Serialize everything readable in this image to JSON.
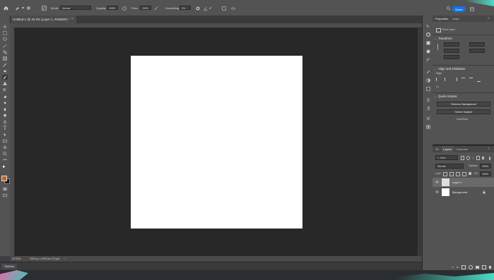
{
  "options_bar": {
    "mode_label": "Mode:",
    "mode_value": "Normal",
    "opacity_label": "Opacity:",
    "opacity_value": "100%",
    "flow_label": "Flow:",
    "flow_value": "100%",
    "smoothing_label": "Smoothing:",
    "smoothing_value": "0%",
    "angle_value": "0°",
    "share_label": "Share"
  },
  "document": {
    "tab_title": "Untitled-1 @ 33.3% (Layer 1, RGB/8#) *"
  },
  "status_bar": {
    "zoom": "33.33%",
    "dimensions": "2000 px x 2000 px (72 ppi)"
  },
  "timeline": {
    "label": "Timeline"
  },
  "properties": {
    "tab_properties": "Properties",
    "tab_adjustments": "Adjus",
    "kind": "Pixel Layer",
    "transform_header": "Transform",
    "align_header": "Align and Distribute",
    "align_label": "Align:",
    "quick_actions_header": "Quick Actions",
    "remove_bg_button": "Remove Background",
    "select_subject_button": "Select Subject",
    "more_link": "Less/Hold"
  },
  "layers": {
    "tab_3d": "3D",
    "tab_layers": "Layers",
    "tab_channels": "Channels",
    "search_kind": "Kind",
    "blend_mode": "Normal",
    "opacity_label": "Opacity:",
    "opacity_value": "100%",
    "lock_label": "Lock:",
    "fill_label": "Fill:",
    "fill_value": "100%",
    "items": [
      {
        "name": "Layer 1"
      },
      {
        "name": "Background"
      }
    ]
  },
  "colors": {
    "foreground": "#c4641e",
    "background": "#1a1a1a",
    "accent": "#1473e6"
  }
}
